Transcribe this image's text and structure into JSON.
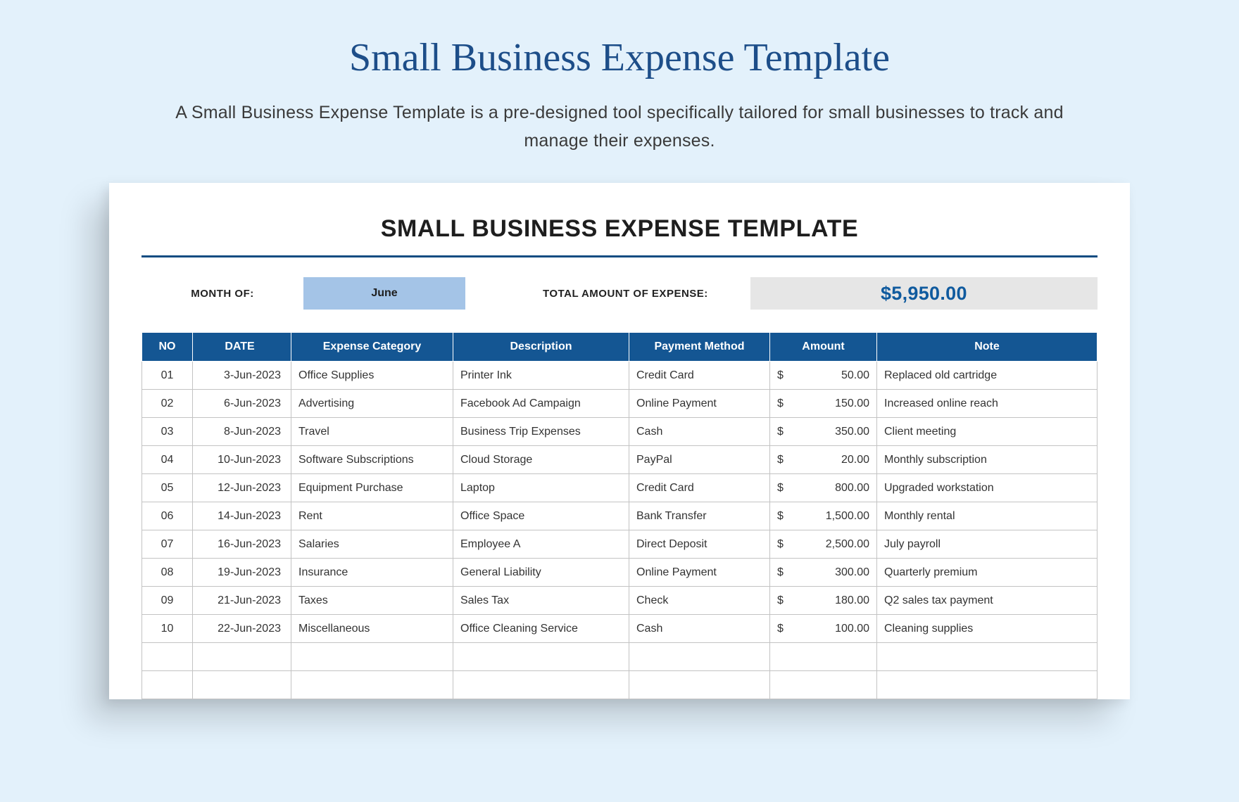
{
  "header": {
    "title": "Small Business Expense Template",
    "subtitle": "A Small Business Expense Template is a pre-designed tool specifically tailored for small businesses to track and manage their expenses."
  },
  "card": {
    "title": "SMALL BUSINESS EXPENSE TEMPLATE",
    "month_label": "MONTH OF:",
    "month_value": "June",
    "total_label": "TOTAL AMOUNT OF EXPENSE:",
    "total_value": "$5,950.00"
  },
  "table": {
    "headers": {
      "no": "NO",
      "date": "DATE",
      "category": "Expense Category",
      "description": "Description",
      "payment": "Payment Method",
      "amount": "Amount",
      "note": "Note"
    },
    "rows": [
      {
        "no": "01",
        "date": "3-Jun-2023",
        "category": "Office Supplies",
        "description": "Printer Ink",
        "payment": "Credit Card",
        "amount": "50.00",
        "note": "Replaced old cartridge"
      },
      {
        "no": "02",
        "date": "6-Jun-2023",
        "category": "Advertising",
        "description": "Facebook Ad Campaign",
        "payment": "Online Payment",
        "amount": "150.00",
        "note": "Increased online reach"
      },
      {
        "no": "03",
        "date": "8-Jun-2023",
        "category": "Travel",
        "description": "Business Trip Expenses",
        "payment": "Cash",
        "amount": "350.00",
        "note": "Client meeting"
      },
      {
        "no": "04",
        "date": "10-Jun-2023",
        "category": "Software Subscriptions",
        "description": "Cloud Storage",
        "payment": "PayPal",
        "amount": "20.00",
        "note": "Monthly subscription"
      },
      {
        "no": "05",
        "date": "12-Jun-2023",
        "category": "Equipment Purchase",
        "description": "Laptop",
        "payment": "Credit Card",
        "amount": "800.00",
        "note": "Upgraded workstation"
      },
      {
        "no": "06",
        "date": "14-Jun-2023",
        "category": "Rent",
        "description": "Office Space",
        "payment": "Bank Transfer",
        "amount": "1,500.00",
        "note": "Monthly rental"
      },
      {
        "no": "07",
        "date": "16-Jun-2023",
        "category": "Salaries",
        "description": "Employee A",
        "payment": "Direct Deposit",
        "amount": "2,500.00",
        "note": "July payroll"
      },
      {
        "no": "08",
        "date": "19-Jun-2023",
        "category": "Insurance",
        "description": "General Liability",
        "payment": "Online Payment",
        "amount": "300.00",
        "note": "Quarterly premium"
      },
      {
        "no": "09",
        "date": "21-Jun-2023",
        "category": "Taxes",
        "description": "Sales Tax",
        "payment": "Check",
        "amount": "180.00",
        "note": "Q2 sales tax payment"
      },
      {
        "no": "10",
        "date": "22-Jun-2023",
        "category": "Miscellaneous",
        "description": "Office Cleaning Service",
        "payment": "Cash",
        "amount": "100.00",
        "note": "Cleaning supplies"
      }
    ],
    "empty_rows": 2
  }
}
